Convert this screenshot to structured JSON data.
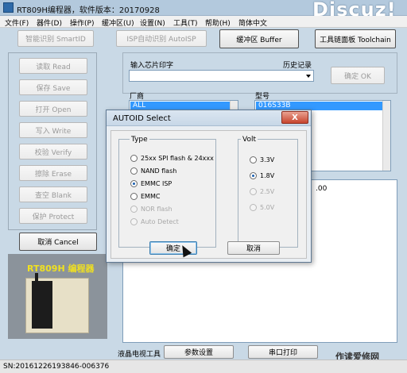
{
  "window": {
    "title": "RT809H编程器，软件版本：20170928",
    "watermark": "Discuz!"
  },
  "menu": [
    "文件(F)",
    "器件(D)",
    "操作(P)",
    "缓冲区(U)",
    "设置(N)",
    "工具(T)",
    "帮助(H)",
    "简体中文"
  ],
  "toolbar": {
    "smart_id": "智能识别 SmartID",
    "isp_auto": "ISP自动识别 AutoISP",
    "buffer": "缓冲区 Buffer",
    "toolchain": "工具链面板 Toolchain"
  },
  "left_actions": {
    "read": "读取 Read",
    "save": "保存 Save",
    "open": "打开 Open",
    "write": "写入 Write",
    "verify": "校验 Verify",
    "erase": "擦除 Erase",
    "blank": "查空 Blank",
    "protect": "保护 Protect",
    "cancel": "取消 Cancel"
  },
  "device_image": {
    "label": "RT809H 编程器"
  },
  "chip_input": {
    "label": "输入芯片印字",
    "history_label": "历史记录",
    "value": "",
    "confirm": "确定 OK"
  },
  "vendor": {
    "label": "厂商",
    "selected": "ALL"
  },
  "model": {
    "label": "型号",
    "selected": "016S33B"
  },
  "log": {
    "partial_text": ".00"
  },
  "bottom_bar": {
    "lcd_tool": "液晶电视工具",
    "params": "参数设置",
    "serial_print": "串口打印"
  },
  "status": {
    "serial": "SN:20161226193846-006376"
  },
  "wechat_label": "作读爱修网",
  "dialog": {
    "title": "AUTOID Select",
    "close": "X",
    "type_group": "Type",
    "volt_group": "Volt",
    "types": [
      {
        "label": "25xx SPI flash & 24xxx",
        "checked": false,
        "enabled": true
      },
      {
        "label": "NAND flash",
        "checked": false,
        "enabled": true
      },
      {
        "label": "EMMC ISP",
        "checked": true,
        "enabled": true
      },
      {
        "label": "EMMC",
        "checked": false,
        "enabled": true
      },
      {
        "label": "NOR flash",
        "checked": false,
        "enabled": false
      },
      {
        "label": "Auto Detect",
        "checked": false,
        "enabled": false
      }
    ],
    "volts": [
      {
        "label": "3.3V",
        "checked": false,
        "enabled": true
      },
      {
        "label": "1.8V",
        "checked": true,
        "enabled": true
      },
      {
        "label": "2.5V",
        "checked": false,
        "enabled": false
      },
      {
        "label": "5.0V",
        "checked": false,
        "enabled": false
      }
    ],
    "ok": "确定",
    "cancel": "取消"
  }
}
